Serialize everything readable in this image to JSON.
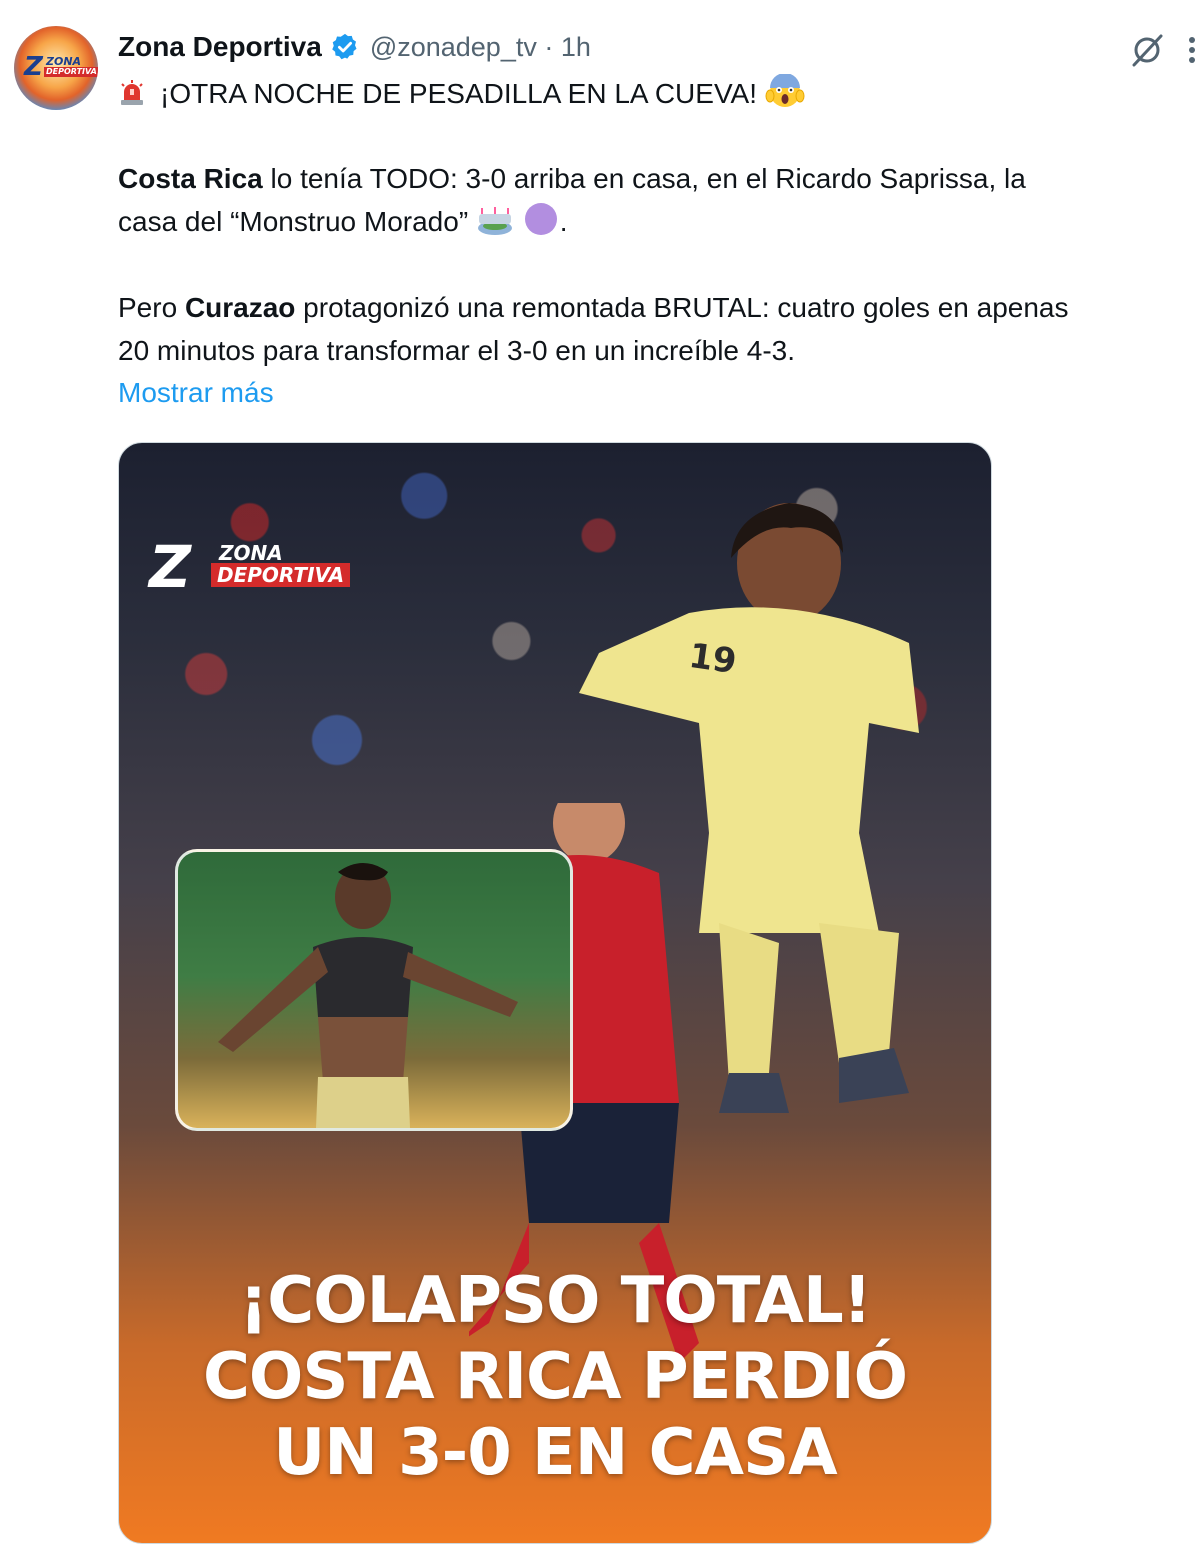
{
  "tweet": {
    "author_name": "Zona Deportiva",
    "handle_time": "@zonadep_tv · 1h",
    "line1": "¡OTRA NOCHE DE PESADILLA EN LA CUEVA!",
    "p2_bold": "Costa Rica",
    "p2_rest": " lo tenía TODO: 3-0 arriba en casa, en el Ricardo Saprissa, la",
    "p2_line2": "casa del “Monstruo Morado”",
    "p3_pre": "Pero ",
    "p3_bold": "Curazao",
    "p3_rest": " protagonizó una remontada BRUTAL: cuatro goles en apenas",
    "p3_line2": "20 minutos para transformar el 3-0 en un increíble 4-3.",
    "show_more": "Mostrar más"
  },
  "media": {
    "logo_line1": "ZONA",
    "logo_line2": "DEPORTIVA",
    "jersey_number": "19",
    "headline_1": "¡COLAPSO TOTAL!",
    "headline_2": "COSTA RICA PERDIÓ",
    "headline_3": "UN 3-0 EN CASA"
  },
  "avatar_text": {
    "line1": "ZONA",
    "line2": "DEPORTIVA"
  },
  "icons": {
    "verified": "verified-badge-icon",
    "grok": "grok-icon",
    "more": "more-options-icon",
    "alarm": "rotating-light-emoji",
    "scream": "face-screaming-emoji",
    "stadium": "stadium-emoji",
    "purple": "purple-circle-emoji"
  },
  "colors": {
    "accent": "#1d9bf0",
    "text": "#0f1419",
    "muted": "#536471",
    "brand_red": "#d42b2b"
  }
}
